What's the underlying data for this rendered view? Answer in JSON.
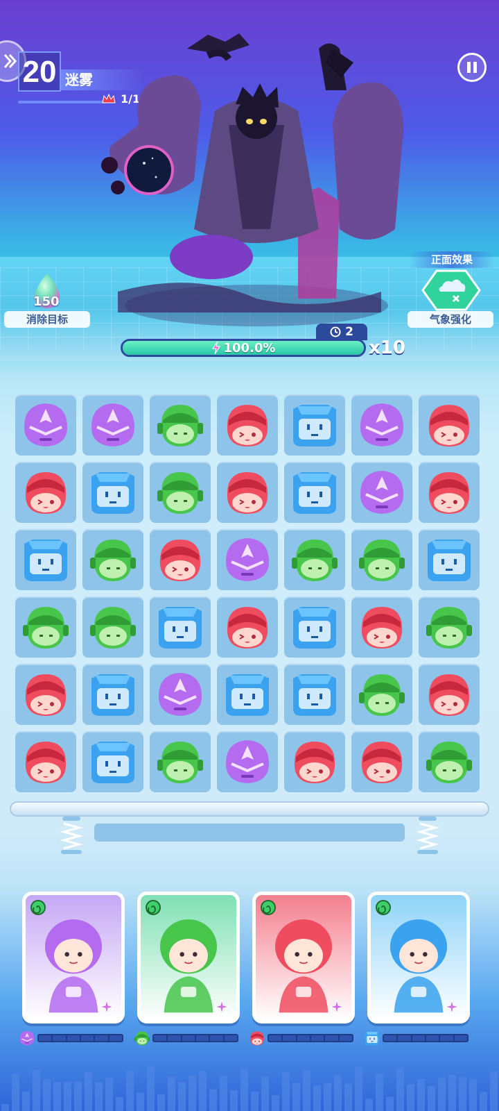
{
  "level": {
    "number": "20",
    "name": "迷雾",
    "wave": "1/1"
  },
  "target": {
    "count": "150",
    "label": "消除目标"
  },
  "effect": {
    "title": "正面效果",
    "label": "气象强化"
  },
  "turns": "2",
  "energy": {
    "text": "100.0%",
    "fraction": 1.0
  },
  "multiplier": "x10",
  "colors": {
    "purple": "#b46bf0",
    "red": "#ef4d5f",
    "green": "#47c64b",
    "blue": "#3aa2ef",
    "energy": "#2ccfaa"
  },
  "board": [
    [
      "purple",
      "purple",
      "green",
      "red",
      "blue",
      "purple",
      "red"
    ],
    [
      "red",
      "blue",
      "green",
      "red",
      "blue",
      "purple",
      "red"
    ],
    [
      "blue",
      "green",
      "red",
      "purple",
      "green",
      "green",
      "blue"
    ],
    [
      "green",
      "green",
      "blue",
      "red",
      "blue",
      "red",
      "green"
    ],
    [
      "red",
      "blue",
      "purple",
      "blue",
      "blue",
      "green",
      "red"
    ],
    [
      "red",
      "blue",
      "green",
      "purple",
      "red",
      "red",
      "green"
    ]
  ],
  "heroes": [
    {
      "name": "purple-hero",
      "element": "purple",
      "bg": "#c6a8f5",
      "energy_segments": 6,
      "energy_filled": 0
    },
    {
      "name": "green-hero",
      "element": "green",
      "bg": "#7fe0b4",
      "energy_segments": 6,
      "energy_filled": 0
    },
    {
      "name": "red-hero",
      "element": "red",
      "bg": "#f47f8f",
      "energy_segments": 6,
      "energy_filled": 0
    },
    {
      "name": "blue-hero",
      "element": "blue",
      "bg": "#8fd3f7",
      "energy_segments": 6,
      "energy_filled": 0
    }
  ]
}
